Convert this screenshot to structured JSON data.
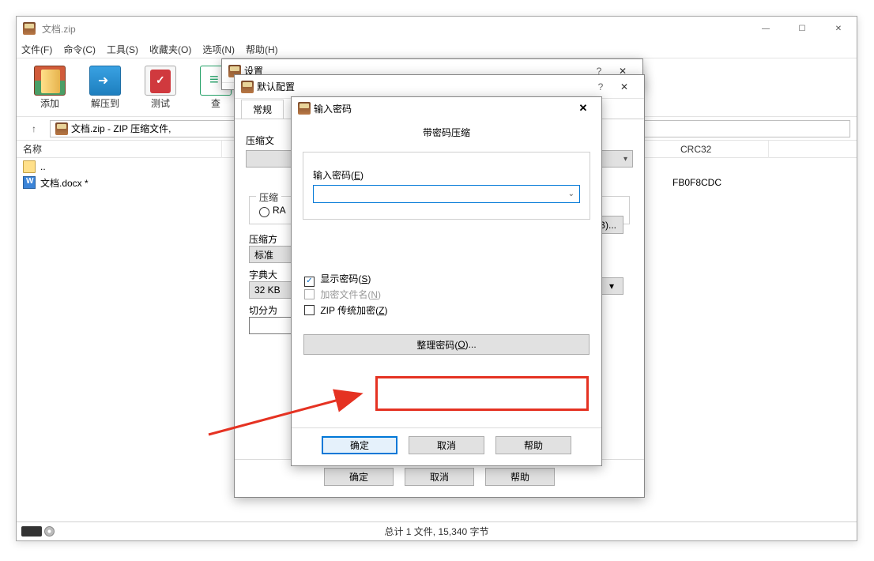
{
  "main": {
    "title": "文档.zip",
    "menu": {
      "file": "文件(F)",
      "cmd": "命令(C)",
      "tool": "工具(S)",
      "fav": "收藏夹(O)",
      "opt": "选项(N)",
      "help": "帮助(H)"
    },
    "toolbar": {
      "add": "添加",
      "extract": "解压到",
      "test": "测试",
      "view": "查"
    },
    "path": "文档.zip - ZIP 压缩文件,",
    "col_name": "名称",
    "col_crc": "CRC32",
    "rows": {
      "up": "..",
      "file": "文档.docx *"
    },
    "crc_value": "FB0F8CDC",
    "status": "总计 1 文件, 15,340 字节"
  },
  "settings": {
    "title": "设置"
  },
  "config": {
    "title": "默认配置",
    "tab_general": "常规",
    "label_compress_file": "压缩文",
    "browse": "(B)...",
    "label_compress_format": "压缩",
    "radio_rar": "RA",
    "label_method": "压缩方",
    "method_value": "标准",
    "label_dict": "字典大",
    "dict_value": "32 KB",
    "label_split": "切分为",
    "ok": "确定",
    "cancel": "取消",
    "help": "帮助"
  },
  "pwd": {
    "title": "输入密码",
    "heading": "带密码压缩",
    "label_input_a": "输入密码(",
    "label_input_u": "E",
    "label_input_b": ")",
    "chk_show_a": "显示密码(",
    "chk_show_u": "S",
    "chk_show_b": ")",
    "chk_encname_a": "加密文件名(",
    "chk_encname_u": "N",
    "chk_encname_b": ")",
    "chk_legacy_a": "ZIP 传统加密(",
    "chk_legacy_u": "Z",
    "chk_legacy_b": ")",
    "organize_a": "整理密码(",
    "organize_u": "O",
    "organize_b": ")...",
    "ok": "确定",
    "cancel": "取消",
    "help": "帮助"
  }
}
